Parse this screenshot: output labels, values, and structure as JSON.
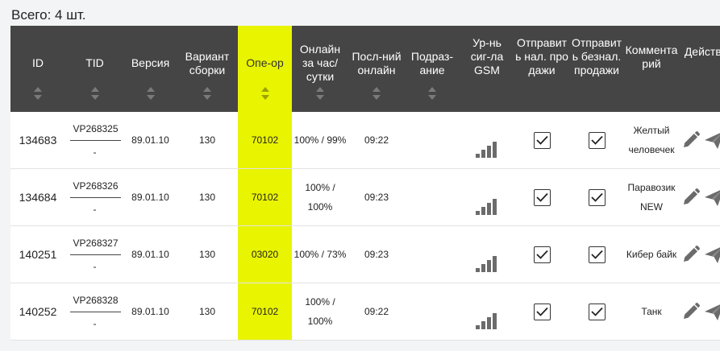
{
  "summary": {
    "total": "Всего: 4 шт."
  },
  "columns": [
    {
      "key": "id",
      "label": "ID"
    },
    {
      "key": "tid",
      "label": "TID"
    },
    {
      "key": "version",
      "label": "Версия"
    },
    {
      "key": "build",
      "label": "Вариант сборки"
    },
    {
      "key": "operator",
      "label": "Опе-ор"
    },
    {
      "key": "online",
      "label": "Онлайн за час/сутки"
    },
    {
      "key": "last_online",
      "label": "Посл-ний онлайн"
    },
    {
      "key": "division",
      "label": "Подраз-ание"
    },
    {
      "key": "gsm",
      "label": "Ур-нь сиг-ла GSM"
    },
    {
      "key": "send_cash",
      "label": "Отправить нал. продажи"
    },
    {
      "key": "send_cashless",
      "label": "Отправить безнал. продажи"
    },
    {
      "key": "comment",
      "label": "Комментарий"
    },
    {
      "key": "actions",
      "label": "Действия"
    }
  ],
  "rows": [
    {
      "id": "134683",
      "tid_top": "VP268325",
      "tid_bottom": "-",
      "version": "89.01.10",
      "build": "130",
      "operator": "70102",
      "online": "100% / 99%",
      "last_online": "09:22",
      "division": "",
      "gsm_level": 4,
      "send_cash": true,
      "send_cashless": true,
      "comment": "Желтый человечек"
    },
    {
      "id": "134684",
      "tid_top": "VP268326",
      "tid_bottom": "-",
      "version": "89.01.10",
      "build": "130",
      "operator": "70102",
      "online": "100% / 100%",
      "last_online": "09:23",
      "division": "",
      "gsm_level": 4,
      "send_cash": true,
      "send_cashless": true,
      "comment": "Паравозик NEW"
    },
    {
      "id": "140251",
      "tid_top": "VP268327",
      "tid_bottom": "-",
      "version": "89.01.10",
      "build": "130",
      "operator": "03020",
      "online": "100% / 73%",
      "last_online": "09:23",
      "division": "",
      "gsm_level": 4,
      "send_cash": true,
      "send_cashless": true,
      "comment": "Кибер байк"
    },
    {
      "id": "140252",
      "tid_top": "VP268328",
      "tid_bottom": "-",
      "version": "89.01.10",
      "build": "130",
      "operator": "70102",
      "online": "100% / 100%",
      "last_online": "09:22",
      "division": "",
      "gsm_level": 4,
      "send_cash": true,
      "send_cashless": true,
      "comment": "Танк"
    }
  ],
  "icons": {
    "edit": "pencil-icon",
    "send": "paper-plane-icon",
    "signal": "signal-bars-icon",
    "check": "checkmark-icon"
  },
  "colors": {
    "header_bg": "#454545",
    "operator_highlight": "#e9f400",
    "icon_gray": "#6b6b6b"
  }
}
